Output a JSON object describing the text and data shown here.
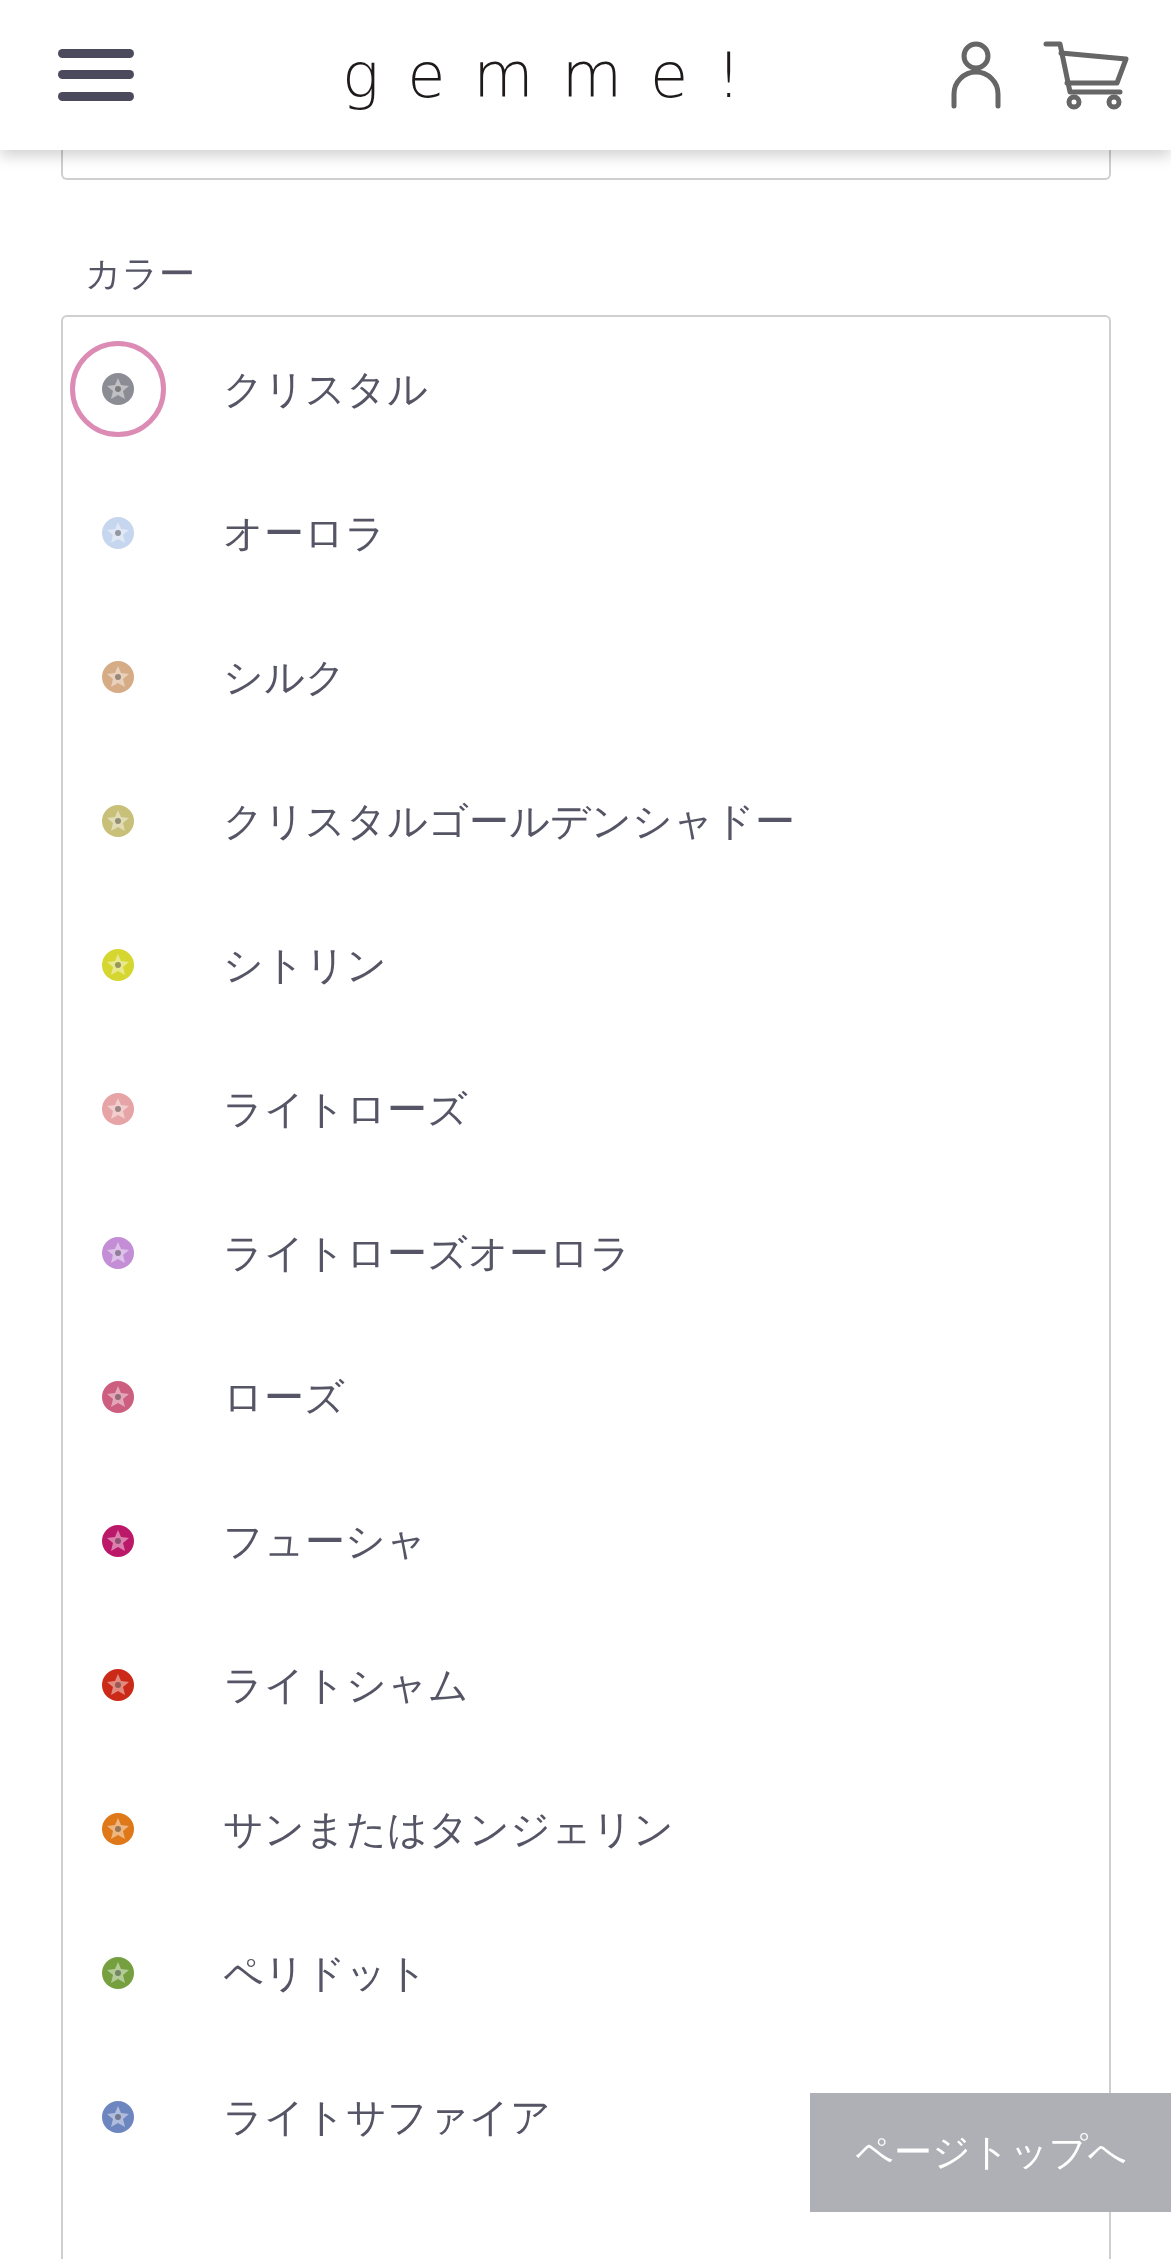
{
  "header": {
    "logo": "gemme!"
  },
  "color_section": {
    "label": "カラー",
    "options": [
      {
        "name": "クリスタル",
        "color": "#8c8c94",
        "selected": true
      },
      {
        "name": "オーロラ",
        "color": "#c6d6ee",
        "selected": false
      },
      {
        "name": "シルク",
        "color": "#d6ac86",
        "selected": false
      },
      {
        "name": "クリスタルゴールデンシャドー",
        "color": "#c8bf78",
        "selected": false
      },
      {
        "name": "シトリン",
        "color": "#d6d630",
        "selected": false
      },
      {
        "name": "ライトローズ",
        "color": "#e6a4a6",
        "selected": false
      },
      {
        "name": "ライトローズオーロラ",
        "color": "#c48ed6",
        "selected": false
      },
      {
        "name": "ローズ",
        "color": "#cc5e80",
        "selected": false
      },
      {
        "name": "フューシャ",
        "color": "#bc186a",
        "selected": false
      },
      {
        "name": "ライトシャム",
        "color": "#cc2a18",
        "selected": false
      },
      {
        "name": "サンまたはタンジェリン",
        "color": "#de7818",
        "selected": false
      },
      {
        "name": "ペリドット",
        "color": "#76a040",
        "selected": false
      },
      {
        "name": "ライトサファイア",
        "color": "#6e86c0",
        "selected": false
      }
    ]
  },
  "page_top_button": "ページトップへ"
}
